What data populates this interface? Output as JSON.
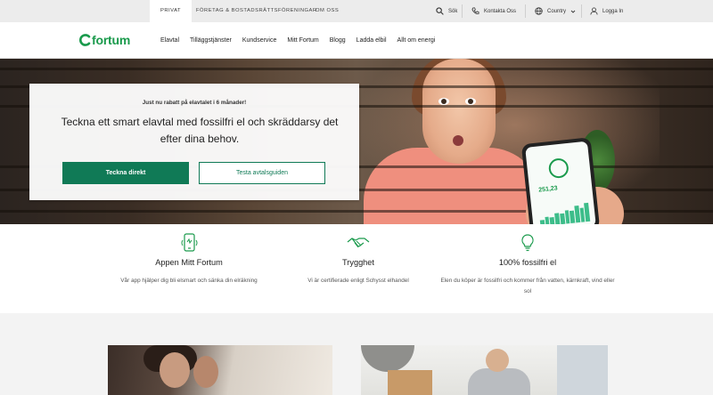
{
  "topbar": {
    "tabs": [
      {
        "label": "PRIVAT",
        "active": true
      },
      {
        "label": "FÖRETAG & BOSTADSRÄTTSFÖRENINGAR",
        "active": false
      },
      {
        "label": "OM OSS",
        "active": false
      }
    ],
    "search_label": "Sök",
    "contact_label": "Kontakta Oss",
    "country_label": "Country",
    "login_label": "Logga In"
  },
  "brand": {
    "name": "fortum",
    "color": "#1a9a4c",
    "accent": "#107a56"
  },
  "nav": {
    "items": [
      "Elavtal",
      "Tilläggstjänster",
      "Kundservice",
      "Mitt Fortum",
      "Blogg",
      "Ladda elbil",
      "Allt om energi"
    ]
  },
  "hero": {
    "kicker": "Just nu rabatt på elavtalet i 6 månader!",
    "headline": "Teckna ett smart elavtal med fossilfri el och skräddarsy det efter dina behov.",
    "primary_cta": "Teckna direkt",
    "secondary_cta": "Testa avtalsguiden",
    "phone_value": "251,23"
  },
  "features": [
    {
      "icon": "phone-app-icon",
      "title": "Appen Mitt Fortum",
      "desc": "Vår app hjälper dig bli elsmart och sänka din elräkning"
    },
    {
      "icon": "handshake-icon",
      "title": "Trygghet",
      "desc": "Vi är certifierade enligt Schysst elhandel"
    },
    {
      "icon": "lightbulb-icon",
      "title": "100% fossilfri el",
      "desc": "Elen du köper är fossilfri och kommer från vatten, kärnkraft, vind eller sol"
    }
  ]
}
